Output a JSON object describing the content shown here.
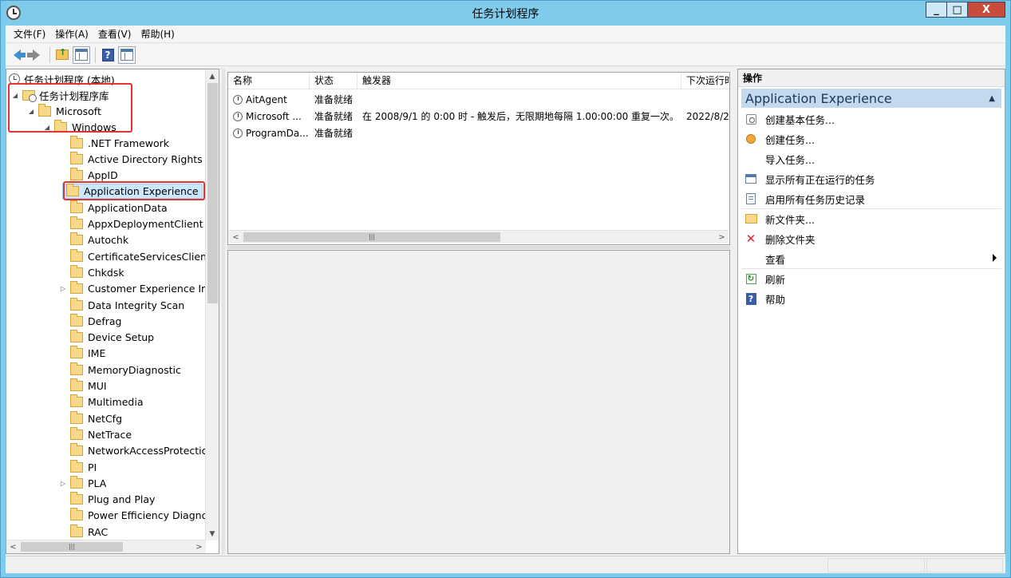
{
  "window": {
    "title": "任务计划程序",
    "buttons": {
      "minimize": "_",
      "maximize": "□",
      "close": "X"
    }
  },
  "menubar": [
    {
      "label": "文件(F)"
    },
    {
      "label": "操作(A)"
    },
    {
      "label": "查看(V)"
    },
    {
      "label": "帮助(H)"
    }
  ],
  "toolbar": {
    "items": [
      "back-icon",
      "forward-icon",
      "folder-up-icon",
      "show-hide-pane-icon",
      "help-icon",
      "show-hide-action-pane-icon"
    ]
  },
  "tree": {
    "root": "任务计划程序 (本地)",
    "library": "任务计划程序库",
    "microsoft": "Microsoft",
    "windows": "Windows",
    "children": [
      {
        "label": ".NET Framework",
        "expandable": false
      },
      {
        "label": "Active Directory Rights M",
        "expandable": false
      },
      {
        "label": "AppID",
        "expandable": false
      },
      {
        "label": "Application Experience",
        "expandable": false,
        "selected": true
      },
      {
        "label": "ApplicationData",
        "expandable": false
      },
      {
        "label": "AppxDeploymentClient",
        "expandable": false
      },
      {
        "label": "Autochk",
        "expandable": false
      },
      {
        "label": "CertificateServicesClient",
        "expandable": false
      },
      {
        "label": "Chkdsk",
        "expandable": false
      },
      {
        "label": "Customer Experience Im",
        "expandable": true
      },
      {
        "label": "Data Integrity Scan",
        "expandable": false
      },
      {
        "label": "Defrag",
        "expandable": false
      },
      {
        "label": "Device Setup",
        "expandable": false
      },
      {
        "label": "IME",
        "expandable": false
      },
      {
        "label": "MemoryDiagnostic",
        "expandable": false
      },
      {
        "label": "MUI",
        "expandable": false
      },
      {
        "label": "Multimedia",
        "expandable": false
      },
      {
        "label": "NetCfg",
        "expandable": false
      },
      {
        "label": "NetTrace",
        "expandable": false
      },
      {
        "label": "NetworkAccessProtection",
        "expandable": false
      },
      {
        "label": "PI",
        "expandable": false
      },
      {
        "label": "PLA",
        "expandable": true
      },
      {
        "label": "Plug and Play",
        "expandable": false
      },
      {
        "label": "Power Efficiency Diagnos",
        "expandable": false
      },
      {
        "label": "RAC",
        "expandable": false
      }
    ]
  },
  "tasks": {
    "columns": [
      "名称",
      "状态",
      "触发器",
      "下次运行时"
    ],
    "rows": [
      {
        "name": "AitAgent",
        "status": "准备就绪",
        "trigger": "",
        "next": ""
      },
      {
        "name": "Microsoft ...",
        "status": "准备就绪",
        "trigger": "在 2008/9/1 的 0:00 时 - 触发后，无限期地每隔 1.00:00:00 重复一次。",
        "next": "2022/8/2"
      },
      {
        "name": "ProgramDa...",
        "status": "准备就绪",
        "trigger": "",
        "next": ""
      }
    ]
  },
  "actions": {
    "header": "操作",
    "section": "Application Experience",
    "items": [
      {
        "label": "创建基本任务...",
        "icon": "create-basic-task-icon"
      },
      {
        "label": "创建任务...",
        "icon": "create-task-icon"
      },
      {
        "label": "导入任务...",
        "icon": ""
      },
      {
        "label": "显示所有正在运行的任务",
        "icon": "running-tasks-icon"
      },
      {
        "label": "启用所有任务历史记录",
        "icon": "history-icon"
      },
      {
        "label": "新文件夹...",
        "icon": "new-folder-icon"
      },
      {
        "label": "删除文件夹",
        "icon": "delete-icon"
      },
      {
        "label": "查看",
        "icon": ""
      },
      {
        "label": "刷新",
        "icon": "refresh-icon"
      },
      {
        "label": "帮助",
        "icon": "help-icon"
      }
    ]
  },
  "colors": {
    "title_bar": "#80cbea",
    "selection": "#cce8ff",
    "action_section": "#c3d9ee",
    "highlight_box": "#e3342f"
  }
}
